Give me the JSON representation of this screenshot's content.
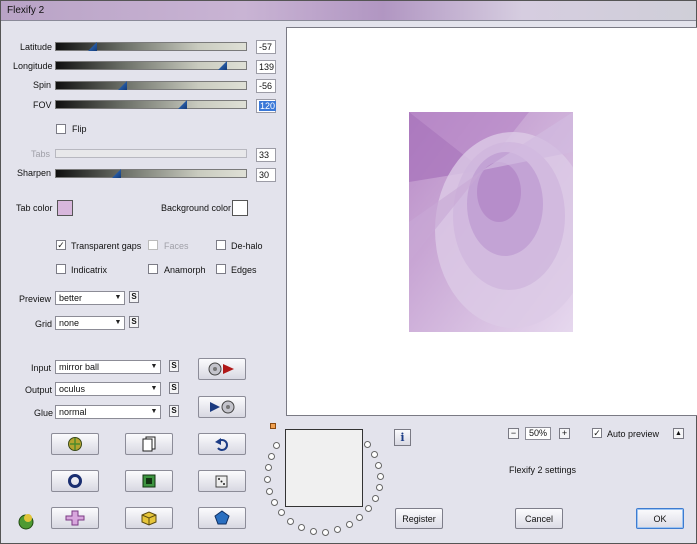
{
  "window": {
    "title": "Flexify 2"
  },
  "sliders": [
    {
      "label": "Latitude",
      "value": "-57",
      "pos": 0.19
    },
    {
      "label": "Longitude",
      "value": "139",
      "pos": 0.86
    },
    {
      "label": "Spin",
      "value": "-56",
      "pos": 0.34
    },
    {
      "label": "FOV",
      "value": "120",
      "pos": 0.67
    }
  ],
  "flip": {
    "label": "Flip"
  },
  "tabs": {
    "label": "Tabs",
    "value": "33"
  },
  "sharpen": {
    "label": "Sharpen",
    "value": "30",
    "pos": 0.31
  },
  "colors": {
    "tab_label": "Tab color",
    "tab_hex": "#d8b7dc",
    "bg_label": "Background color",
    "bg_hex": "#ffffff"
  },
  "checks": {
    "transparent_gaps": "Transparent gaps",
    "faces": "Faces",
    "dehalo": "De-halo",
    "indicatrix": "Indicatrix",
    "anamorph": "Anamorph",
    "edges": "Edges"
  },
  "preview_opt": {
    "label": "Preview",
    "value": "better"
  },
  "grid": {
    "label": "Grid",
    "value": "none"
  },
  "input": {
    "label": "Input",
    "value": "mirror ball"
  },
  "output": {
    "label": "Output",
    "value": "oculus"
  },
  "glue": {
    "label": "Glue",
    "value": "normal"
  },
  "s_label": "S",
  "zoom": {
    "minus": "−",
    "value": "50%",
    "plus": "+"
  },
  "auto_preview": {
    "label": "Auto preview",
    "checked": "✓"
  },
  "settings_name": "Flexify 2 settings",
  "info_label": "i",
  "up_label": "▲",
  "buttons": {
    "register": "Register",
    "cancel": "Cancel",
    "ok": "OK"
  },
  "accent": "#3d7bd0"
}
